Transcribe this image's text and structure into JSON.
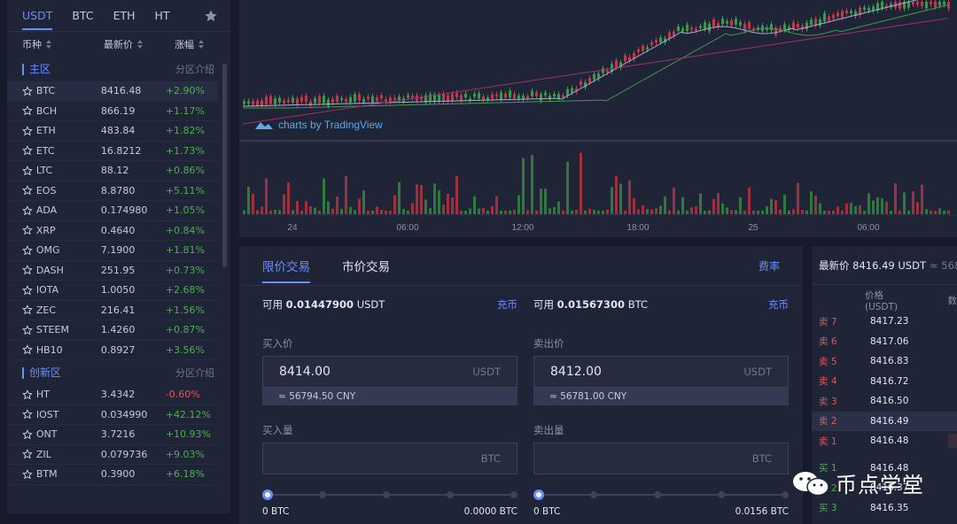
{
  "market_tabs": [
    "USDT",
    "BTC",
    "ETH",
    "HT"
  ],
  "columns": {
    "symbol": "币种",
    "price": "最新价",
    "change": "涨幅"
  },
  "sections": [
    {
      "title": "主区",
      "link": "分区介绍",
      "rows": [
        {
          "symbol": "BTC",
          "price": "8416.48",
          "change": "+2.90%",
          "dir": "up"
        },
        {
          "symbol": "BCH",
          "price": "866.19",
          "change": "+1.17%",
          "dir": "up"
        },
        {
          "symbol": "ETH",
          "price": "483.84",
          "change": "+1.82%",
          "dir": "up"
        },
        {
          "symbol": "ETC",
          "price": "16.8212",
          "change": "+1.73%",
          "dir": "up"
        },
        {
          "symbol": "LTC",
          "price": "88.12",
          "change": "+0.86%",
          "dir": "up"
        },
        {
          "symbol": "EOS",
          "price": "8.8780",
          "change": "+5.11%",
          "dir": "up"
        },
        {
          "symbol": "ADA",
          "price": "0.174980",
          "change": "+1.05%",
          "dir": "up"
        },
        {
          "symbol": "XRP",
          "price": "0.4640",
          "change": "+0.84%",
          "dir": "up"
        },
        {
          "symbol": "OMG",
          "price": "7.1900",
          "change": "+1.81%",
          "dir": "up"
        },
        {
          "symbol": "DASH",
          "price": "251.95",
          "change": "+0.73%",
          "dir": "up"
        },
        {
          "symbol": "IOTA",
          "price": "1.0050",
          "change": "+2.68%",
          "dir": "up"
        },
        {
          "symbol": "ZEC",
          "price": "216.41",
          "change": "+1.56%",
          "dir": "up"
        },
        {
          "symbol": "STEEM",
          "price": "1.4260",
          "change": "+0.87%",
          "dir": "up"
        },
        {
          "symbol": "HB10",
          "price": "0.8927",
          "change": "+3.56%",
          "dir": "up"
        }
      ]
    },
    {
      "title": "创新区",
      "link": "分区介绍",
      "rows": [
        {
          "symbol": "HT",
          "price": "3.4342",
          "change": "-0.60%",
          "dir": "dn"
        },
        {
          "symbol": "IOST",
          "price": "0.034990",
          "change": "+42.12%",
          "dir": "up"
        },
        {
          "symbol": "ONT",
          "price": "3.7216",
          "change": "+10.93%",
          "dir": "up"
        },
        {
          "symbol": "ZIL",
          "price": "0.079736",
          "change": "+9.03%",
          "dir": "up"
        },
        {
          "symbol": "BTM",
          "price": "0.3900",
          "change": "+6.18%",
          "dir": "up"
        }
      ]
    }
  ],
  "chart": {
    "attribution": "charts by TradingView",
    "time_labels": [
      "24",
      "06:00",
      "12:00",
      "18:00",
      "25",
      "06:00"
    ]
  },
  "trade": {
    "tabs": [
      "限价交易",
      "市价交易"
    ],
    "fee_link": "费率",
    "buy": {
      "avail_label": "可用",
      "avail_amount": "0.01447900",
      "avail_unit": "USDT",
      "deposit": "充币",
      "price_label": "买入价",
      "price": "8414.00",
      "price_unit": "USDT",
      "cny": "≈ 56794.50 CNY",
      "qty_label": "买入量",
      "qty_unit": "BTC",
      "slider_min": "0 BTC",
      "slider_max": "0.0000 BTC",
      "slider_level": 0
    },
    "sell": {
      "avail_label": "可用",
      "avail_amount": "0.01567300",
      "avail_unit": "BTC",
      "deposit": "充币",
      "price_label": "卖出价",
      "price": "8412.00",
      "price_unit": "USDT",
      "cny": "≈ 56781.00 CNY",
      "qty_label": "卖出量",
      "qty_unit": "BTC",
      "slider_min": "0 BTC",
      "slider_max": "0.0156 BTC",
      "slider_level": 0
    }
  },
  "orderbook": {
    "latest_label": "最新价",
    "latest_price": "8416.49 USDT",
    "latest_cny": "≈ 568",
    "col_price": "价格(USDT)",
    "col_qty": "数",
    "asks": [
      {
        "label": "卖 7",
        "price": "8417.23"
      },
      {
        "label": "卖 6",
        "price": "8417.06"
      },
      {
        "label": "卖 5",
        "price": "8416.83"
      },
      {
        "label": "卖 4",
        "price": "8416.72"
      },
      {
        "label": "卖 3",
        "price": "8416.50"
      },
      {
        "label": "卖 2",
        "price": "8416.49"
      },
      {
        "label": "卖 1",
        "price": "8416.48"
      }
    ],
    "bids": [
      {
        "label": "买 1",
        "price": "8416.48"
      },
      {
        "label": "买 2",
        "price": "8416.37"
      },
      {
        "label": "买 3",
        "price": "8416.35"
      }
    ]
  },
  "watermark": "币点学堂",
  "colors": {
    "accent": "#6b8cff",
    "up": "#4caf50",
    "down": "#e05656",
    "panel": "#1f2437",
    "background": "#161a2b"
  }
}
